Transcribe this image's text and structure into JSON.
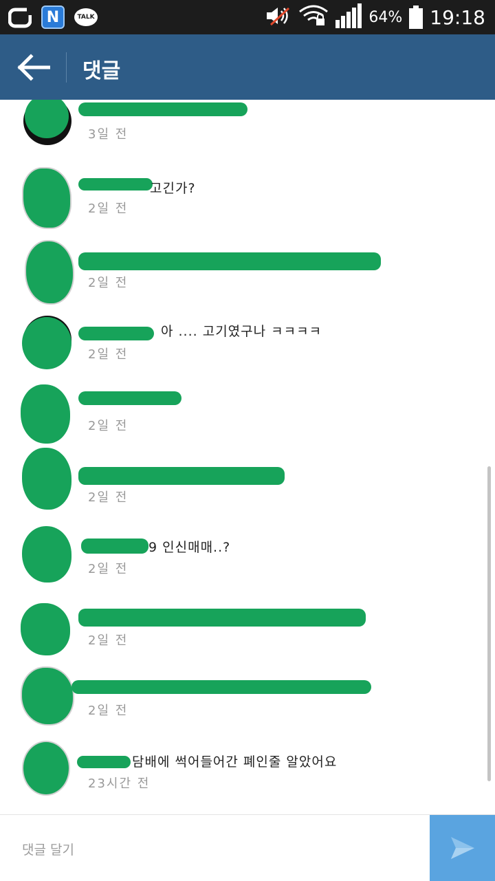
{
  "status_bar": {
    "notification_icons": [
      "o-app-icon",
      "naver-icon",
      "kakaotalk-icon"
    ],
    "talk_label": "TALK",
    "naver_label": "N",
    "battery_percent": "64%",
    "time": "19:18"
  },
  "app_bar": {
    "title": "댓글",
    "back_icon": "arrow-left-icon"
  },
  "comments": [
    {
      "text": "",
      "time": "3일 전"
    },
    {
      "text": "고긴가?",
      "time": "2일 전"
    },
    {
      "text": "",
      "time": "2일 전"
    },
    {
      "text": "아 .... 고기였구나 ㅋㅋㅋㅋ",
      "time": "2일 전"
    },
    {
      "text": "",
      "time": "2일 전"
    },
    {
      "text": "",
      "time": "2일 전"
    },
    {
      "text": "9 인신매매..?",
      "time": "2일 전"
    },
    {
      "text": "",
      "time": "2일 전"
    },
    {
      "text": "",
      "time": "2일 전"
    },
    {
      "text": "담배에 썩어들어간 폐인줄 알았어요",
      "time": "23시간 전"
    }
  ],
  "input": {
    "placeholder": "댓글 달기"
  },
  "colors": {
    "app_bar": "#2e5c87",
    "redaction_green": "#17a35a",
    "send_button": "#5aa4e0"
  }
}
